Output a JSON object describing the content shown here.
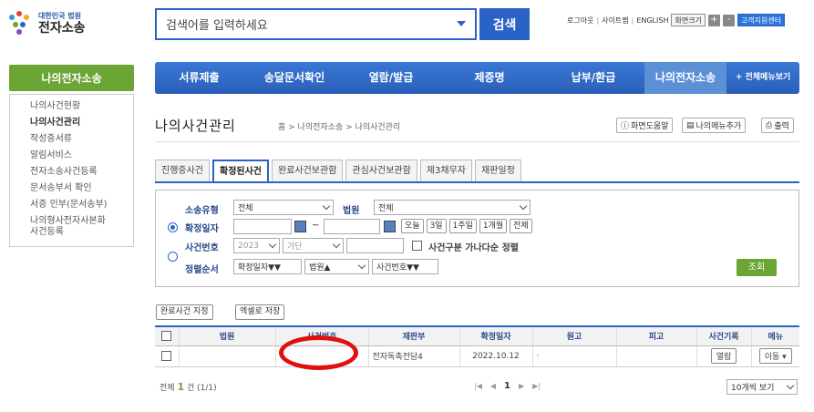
{
  "header": {
    "logo_sub": "대한민국 법원",
    "logo_main": "전자소송",
    "search_placeholder": "검색어를 입력하세요",
    "search_button": "검색",
    "links": [
      "로그아웃",
      "사이트맵",
      "ENGLISH"
    ],
    "font_size_label": "화면크기",
    "plus": "+",
    "minus": "-",
    "support": "고객지원센터"
  },
  "left": {
    "title": "나의전자소송",
    "items": [
      "나의사건현황",
      "나의사건관리",
      "작성중서류",
      "알림서비스",
      "전자소송사건등록",
      "문서송부서 확인",
      "서증 인부(문서송부)",
      "나의형사전자사본화",
      "사건등록"
    ]
  },
  "gnb": {
    "items": [
      "서류제출",
      "송달문서확인",
      "열람/발급",
      "제증명",
      "납부/환급",
      "나의전자소송"
    ],
    "all_menu": "+ 전체메뉴보기"
  },
  "page": {
    "title": "나의사건관리",
    "breadcrumb": "홈 > 나의전자소송 > 나의사건관리",
    "help": "화면도움말",
    "add_my_menu": "나의메뉴추가",
    "print": "출력"
  },
  "tabs": [
    "진행중사건",
    "확정된사건",
    "완료사건보관함",
    "관심사건보관함",
    "제3채무자",
    "재판일정"
  ],
  "filter": {
    "case_type_label": "소송유형",
    "case_type_value": "전체",
    "court_label": "법원",
    "court_value": "전체",
    "confirm_date_label": "확정일자",
    "tilde": "~",
    "period_buttons": [
      "오늘",
      "3일",
      "1주일",
      "1개월",
      "전체"
    ],
    "case_number_label": "사건번호",
    "year_value": "2023",
    "class_value": "가단",
    "case_sort_check": "사건구분 가나다순 정렬",
    "sort_label": "정렬순서",
    "sort1": "확정일자▼▼",
    "sort2": "법원▲",
    "sort3": "사건번호▼▼",
    "search_button": "조회"
  },
  "actions": {
    "complete": "완료사건 지정",
    "excel": "엑셀로 저장"
  },
  "table": {
    "headers": [
      "법원",
      "사건번호",
      "재판부",
      "확정일자",
      "원고",
      "피고",
      "사건기록",
      "메뉴"
    ],
    "row": {
      "court": "",
      "case_no": "",
      "division": "전자독촉전담4",
      "date": "2022.10.12",
      "plaintiff": "·",
      "defendant": "",
      "record_btn": "열람",
      "menu_btn": "이동 ▾"
    }
  },
  "footer": {
    "total_prefix": "전체",
    "total_count": "1",
    "total_suffix": "건 (1/1)",
    "pager_first": "|◀",
    "pager_prev": "◀",
    "page": "1",
    "pager_next": "▶",
    "pager_last": "▶|",
    "per_page": "10개씩 보기"
  },
  "colors": {
    "accent": "#2a63c5",
    "green": "#6ba535",
    "annotation": "#e01010"
  }
}
